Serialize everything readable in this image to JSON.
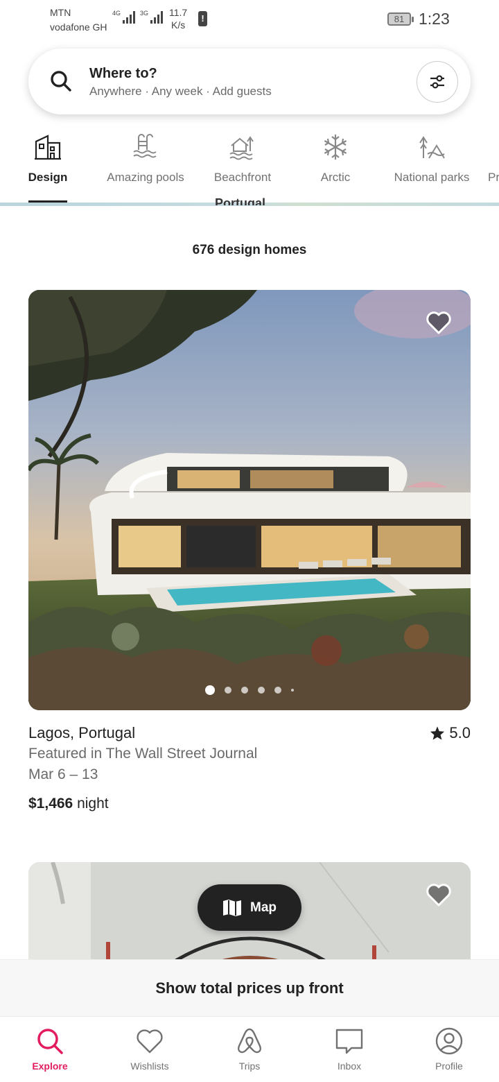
{
  "status_bar": {
    "carrier1": "MTN",
    "carrier2": "vodafone GH",
    "net1": "4G",
    "net2": "3G",
    "speed_value": "11.7",
    "speed_unit": "K/s",
    "battery": "81",
    "time": "1:23"
  },
  "search": {
    "title": "Where to?",
    "subtitle": "Anywhere · Any week · Add guests"
  },
  "categories": [
    {
      "label": "Design",
      "icon": "design-building-icon",
      "active": true
    },
    {
      "label": "Amazing pools",
      "icon": "pool-icon",
      "active": false
    },
    {
      "label": "Beachfront",
      "icon": "beach-house-icon",
      "active": false
    },
    {
      "label": "Arctic",
      "icon": "snowflake-icon",
      "active": false
    },
    {
      "label": "National parks",
      "icon": "mountain-trees-icon",
      "active": false
    },
    {
      "label": "Pr",
      "icon": "",
      "active": false
    }
  ],
  "map_peek_text": "Portugal",
  "results_count": "676 design homes",
  "listing1": {
    "location": "Lagos, Portugal",
    "rating": "5.0",
    "featured": "Featured in The Wall Street Journal",
    "dates": "Mar 6 – 13",
    "price": "$1,466",
    "price_unit": "night"
  },
  "map_button": "Map",
  "total_banner": "Show total prices up front",
  "nav": [
    {
      "label": "Explore",
      "icon": "search-icon",
      "active": true
    },
    {
      "label": "Wishlists",
      "icon": "heart-icon",
      "active": false
    },
    {
      "label": "Trips",
      "icon": "airbnb-logo-icon",
      "active": false
    },
    {
      "label": "Inbox",
      "icon": "message-icon",
      "active": false
    },
    {
      "label": "Profile",
      "icon": "profile-icon",
      "active": false
    }
  ],
  "colors": {
    "accent": "#e31c5f",
    "text": "#222222",
    "muted": "#717171"
  }
}
